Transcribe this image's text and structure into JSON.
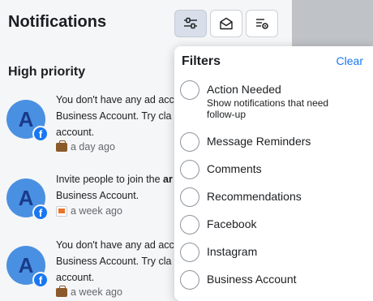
{
  "header": {
    "title": "Notifications",
    "buttons": [
      {
        "name": "filter",
        "icon": "sliders-icon",
        "active": true
      },
      {
        "name": "mark-read",
        "icon": "envelope-open-icon",
        "active": false
      },
      {
        "name": "settings",
        "icon": "list-gear-icon",
        "active": false
      }
    ]
  },
  "section": {
    "title": "High priority"
  },
  "notifications": [
    {
      "avatar_letter": "A",
      "line1": "You don't have any ad acc",
      "line2": "Business Account. Try cla",
      "line3": "account.",
      "meta_icon": "briefcase-icon",
      "time": "a day ago"
    },
    {
      "avatar_letter": "A",
      "line1_prefix": "Invite people to join the ",
      "line1_bold": "ar",
      "line2": "Business Account.",
      "meta_icon": "flag-icon",
      "time": "a week ago"
    },
    {
      "avatar_letter": "A",
      "line1": "You don't have any ad acc",
      "line2": "Business Account. Try cla",
      "line3": "account.",
      "meta_icon": "briefcase-icon",
      "time": "a week ago"
    }
  ],
  "filters": {
    "title": "Filters",
    "clear_label": "Clear",
    "options": [
      {
        "label": "Action Needed",
        "sub": "Show notifications that need",
        "sub2": "follow-up"
      },
      {
        "label": "Message Reminders"
      },
      {
        "label": "Comments"
      },
      {
        "label": "Recommendations"
      },
      {
        "label": "Facebook"
      },
      {
        "label": "Instagram"
      },
      {
        "label": "Business Account"
      }
    ]
  },
  "colors": {
    "accent": "#1877f2",
    "avatar_bg": "#4a90e2",
    "active_button_bg": "#d8dfea"
  }
}
